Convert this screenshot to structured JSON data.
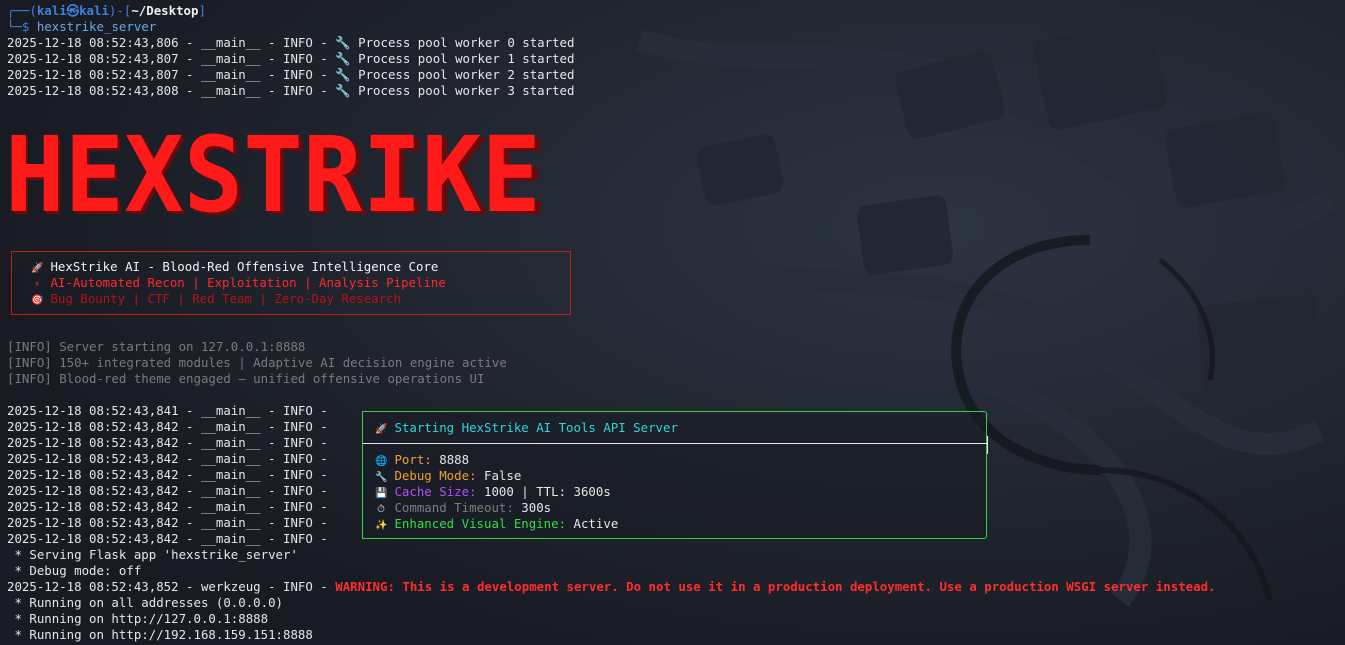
{
  "prompt": {
    "open": "┌──(",
    "user": "kali㉿kali",
    "close": ")-[",
    "path": "~/Desktop",
    "end": "]",
    "cmd_prefix": "└─$ ",
    "command": "hexstrike_server"
  },
  "worker_logs": [
    "2025-12-18 08:52:43,806 - __main__ - INFO - 🔧 Process pool worker 0 started",
    "2025-12-18 08:52:43,807 - __main__ - INFO - 🔧 Process pool worker 1 started",
    "2025-12-18 08:52:43,807 - __main__ - INFO - 🔧 Process pool worker 2 started",
    "2025-12-18 08:52:43,808 - __main__ - INFO - 🔧 Process pool worker 3 started"
  ],
  "banner": {
    "logo_text": "HEXSTRIKE",
    "line1_icon": "🚀",
    "line1": "HexStrike AI - Blood-Red Offensive Intelligence Core",
    "line2_icon": "⚡",
    "line2": "AI-Automated Recon | Exploitation | Analysis Pipeline",
    "line3_icon": "🎯",
    "line3": "Bug Bounty | CTF | Red Team | Zero-Day Research"
  },
  "info_lines": [
    "[INFO] Server starting on 127.0.0.1:8888",
    "[INFO] 150+ integrated modules | Adaptive AI decision engine active",
    "[INFO] Blood-red theme engaged — unified offensive operations UI"
  ],
  "startup_logs": [
    "2025-12-18 08:52:43,841 - __main__ - INFO -",
    "2025-12-18 08:52:43,842 - __main__ - INFO -",
    "2025-12-18 08:52:43,842 - __main__ - INFO -",
    "2025-12-18 08:52:43,842 - __main__ - INFO -",
    "2025-12-18 08:52:43,842 - __main__ - INFO -",
    "2025-12-18 08:52:43,842 - __main__ - INFO -",
    "2025-12-18 08:52:43,842 - __main__ - INFO -",
    "2025-12-18 08:52:43,842 - __main__ - INFO -",
    "2025-12-18 08:52:43,842 - __main__ - INFO -"
  ],
  "status_box": {
    "title_icon": "🚀",
    "title": "Starting HexStrike AI Tools API Server",
    "port_icon": "🌐",
    "port_label": "Port:",
    "port_value": "8888",
    "debug_icon": "🔧",
    "debug_label": "Debug Mode:",
    "debug_value": "False",
    "cache_icon": "💾",
    "cache_label": "Cache Size:",
    "cache_value": "1000 | TTL: 3600s",
    "timeout_icon": "⏱",
    "timeout_label": "Command Timeout:",
    "timeout_value": "300s",
    "engine_icon": "✨",
    "engine_label": "Enhanced Visual Engine:",
    "engine_value": "Active"
  },
  "flask": {
    "serving": " * Serving Flask app 'hexstrike_server'",
    "debug": " * Debug mode: off",
    "warn_prefix": "2025-12-18 08:52:43,852 - werkzeug - INFO - ",
    "warn_text": "WARNING: This is a development server. Do not use it in a production deployment. Use a production WSGI server instead.",
    "running_all": " * Running on all addresses (0.0.0.0)",
    "running_local": " * Running on http://127.0.0.1:8888",
    "running_lan": " * Running on http://192.168.159.151:8888"
  },
  "colors": {
    "background": "#1b1f28",
    "prompt_blue": "#3d82d8",
    "banner_red": "#ff1a1a",
    "box_green": "#37d13f",
    "warning_red": "#ff2d2d"
  }
}
